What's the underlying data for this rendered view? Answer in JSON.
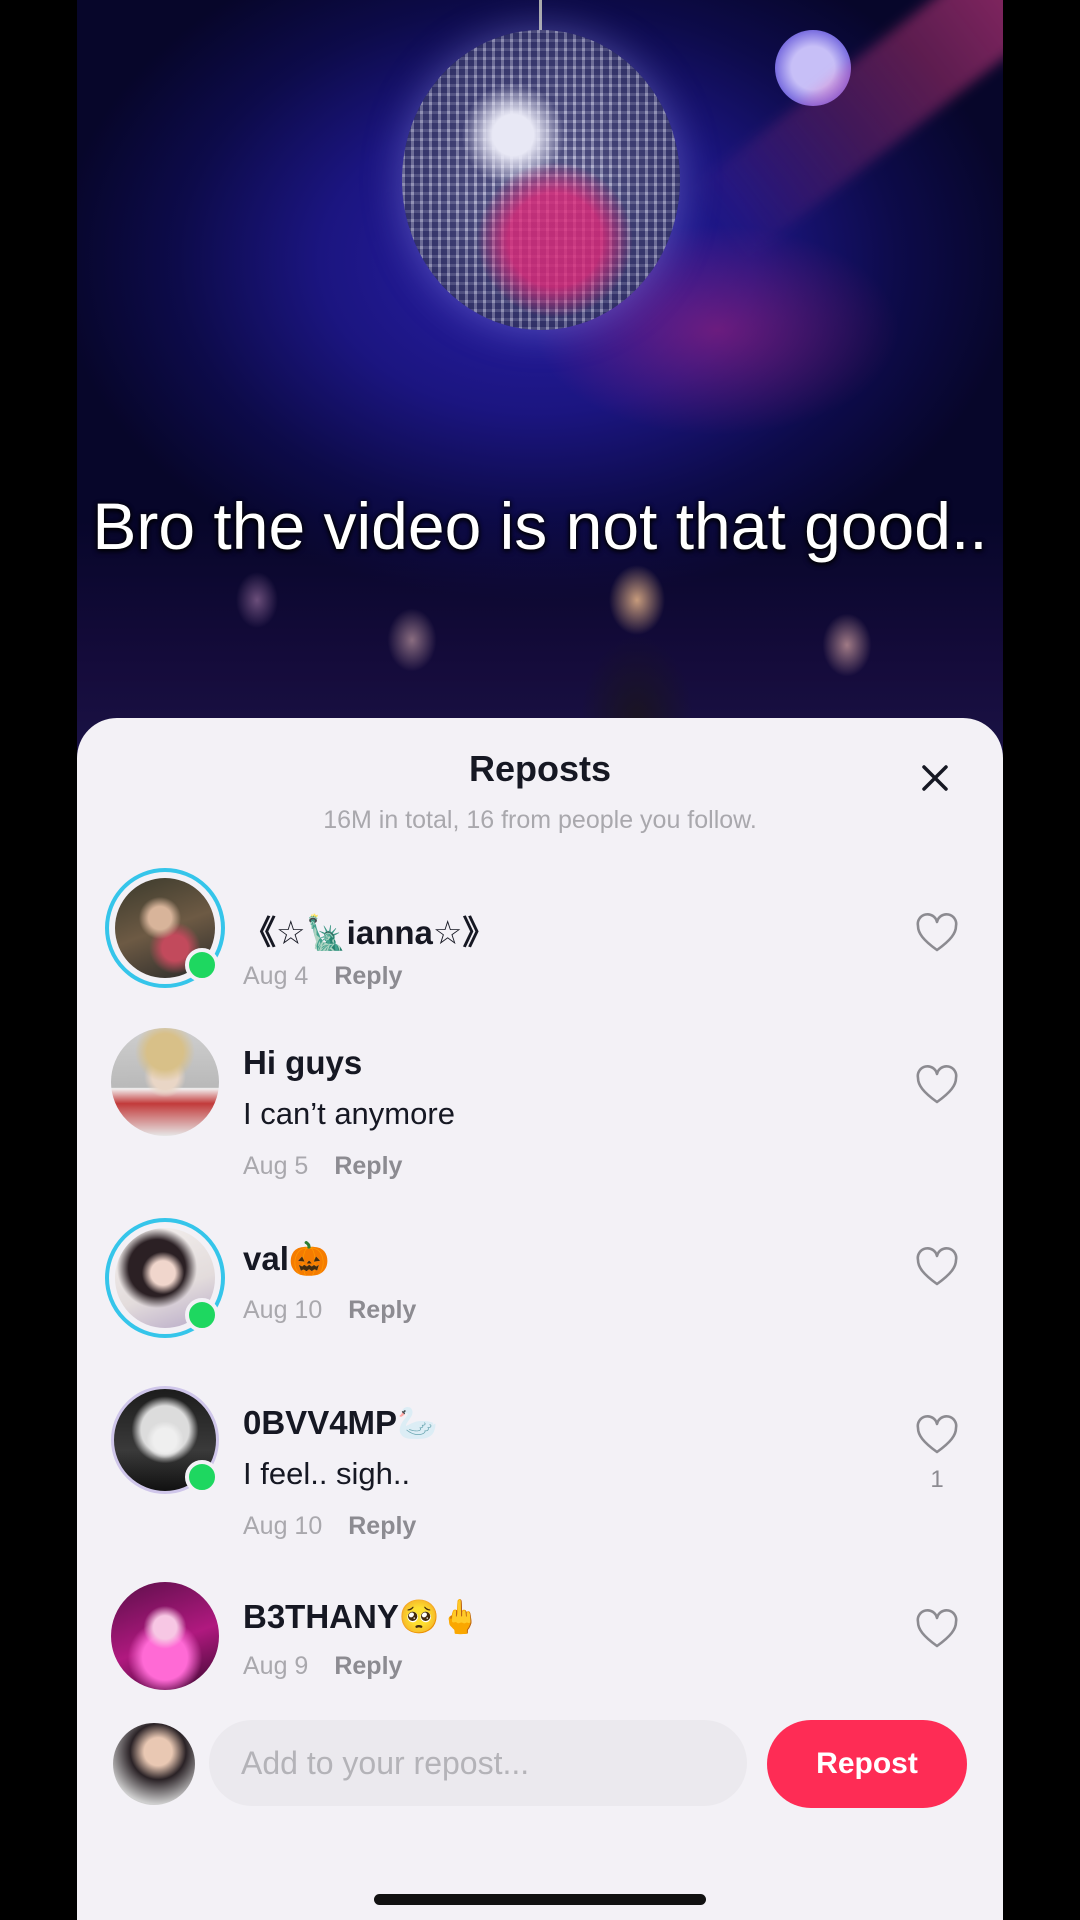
{
  "video": {
    "caption": "Bro the video is not that good.."
  },
  "sheet": {
    "title": "Reposts",
    "subtitle": "16M in total, 16 from people you follow."
  },
  "reposts": [
    {
      "username": "《☆🗽ianna☆》",
      "text": "",
      "date": "Aug 4",
      "reply": "Reply",
      "likes": ""
    },
    {
      "username": "Hi guys",
      "text": "I can’t anymore",
      "date": "Aug 5",
      "reply": "Reply",
      "likes": ""
    },
    {
      "username": "val🎃",
      "text": "",
      "date": "Aug 10",
      "reply": "Reply",
      "likes": ""
    },
    {
      "username": "0BVV4MP🦢",
      "text": "I feel.. sigh..",
      "date": "Aug 10",
      "reply": "Reply",
      "likes": "1"
    },
    {
      "username": "B3THANY🥺🖕",
      "text": "",
      "date": "Aug 9",
      "reply": "Reply",
      "likes": ""
    }
  ],
  "composer": {
    "placeholder": "Add to your repost...",
    "button": "Repost"
  },
  "colors": {
    "accent": "#fe2c55",
    "ring": "#35c5ea",
    "online": "#1ed760",
    "sheet_bg": "#f3f1f6"
  }
}
